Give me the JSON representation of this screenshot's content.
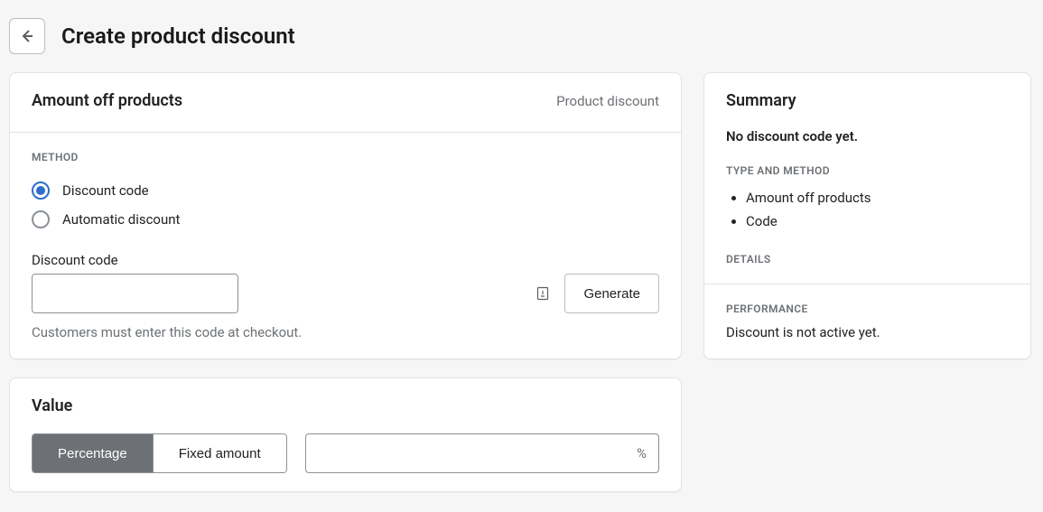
{
  "header": {
    "title": "Create product discount"
  },
  "main": {
    "amount_off": {
      "title": "Amount off products",
      "badge": "Product discount",
      "method_heading": "METHOD",
      "radios": {
        "discount_code": "Discount code",
        "automatic": "Automatic discount"
      },
      "code_field_label": "Discount code",
      "code_value": "",
      "generate_label": "Generate",
      "code_help": "Customers must enter this code at checkout."
    },
    "value": {
      "title": "Value",
      "percentage_label": "Percentage",
      "fixed_label": "Fixed amount",
      "suffix": "%",
      "value_input": ""
    }
  },
  "summary": {
    "title": "Summary",
    "status": "No discount code yet.",
    "type_method_heading": "TYPE AND METHOD",
    "items": {
      "item1": "Amount off products",
      "item2": "Code"
    },
    "details_heading": "DETAILS",
    "performance_heading": "PERFORMANCE",
    "performance_text": "Discount is not active yet."
  }
}
